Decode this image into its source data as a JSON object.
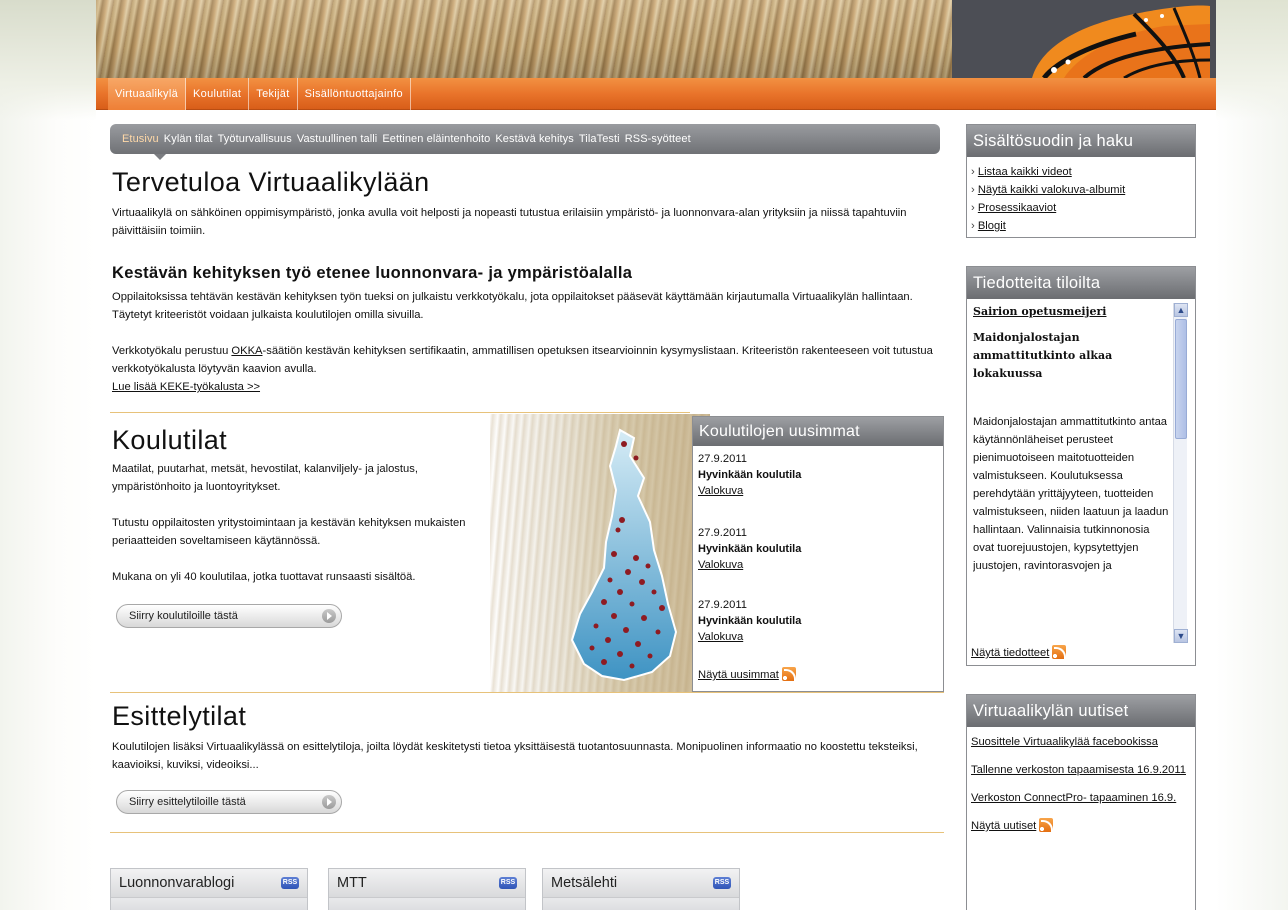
{
  "main_nav": {
    "items": [
      {
        "label": "Virtuaalikylä",
        "active": true
      },
      {
        "label": "Koulutilat",
        "active": false
      },
      {
        "label": "Tekijät",
        "active": false
      },
      {
        "label": "Sisällöntuottajainfo",
        "active": false
      }
    ]
  },
  "sub_nav": {
    "items": [
      {
        "label": "Etusivu",
        "active": true
      },
      {
        "label": "Kylän tilat"
      },
      {
        "label": "Työturvallisuus"
      },
      {
        "label": "Vastuullinen talli"
      },
      {
        "label": "Eettinen eläintenhoito"
      },
      {
        "label": "Kestävä kehitys"
      },
      {
        "label": "TilaTesti"
      },
      {
        "label": "RSS-syötteet"
      }
    ]
  },
  "welcome": {
    "title": "Tervetuloa Virtuaalikylään",
    "text": "Virtuaalikylä on sähköinen oppimisympäristö, jonka avulla voit helposti ja nopeasti tutustua erilaisiin ympäristö- ja luonnonvara-alan yrityksiin ja niissä tapahtuviin päivittäisiin toimiin."
  },
  "keke": {
    "title": "Kestävän kehityksen työ etenee luonnonvara- ja ympäristöalalla",
    "text1": "Oppilaitoksissa tehtävän kestävän kehityksen työn tueksi on julkaistu verkkotyökalu, jota oppilaitokset pääsevät käyttämään kirjautumalla Virtuaalikylän hallintaan. Täytetyt kriteeristöt voidaan julkaista koulutilojen omilla sivuilla.",
    "text2_before": "Verkkotyökalu perustuu ",
    "text2_link": "OKKA",
    "text2_after": "-säätiön kestävän kehityksen sertifikaatin, ammatillisen opetuksen itsearvioinnin kysymyslistaan. Kriteeristön rakenteeseen voit tutustua verkkotyökalusta löytyvän kaavion avulla.",
    "read_more": "Lue lisää KEKE-työkalusta >>"
  },
  "koulutilat": {
    "title": "Koulutilat",
    "text1": "Maatilat, puutarhat, metsät, hevostilat, kalanviljely- ja jalostus, ympäristönhoito ja luontoyritykset.",
    "text2": "Tutustu oppilaitosten yritystoimintaan ja kestävän kehityksen mukaisten periaatteiden soveltamiseen käytännössä.",
    "text3": "Mukana on yli 40 koulutilaa, jotka tuottavat runsaasti sisältöä.",
    "button": "Siirry koulutiloille tästä"
  },
  "newest": {
    "title": "Koulutilojen uusimmat",
    "items": [
      {
        "date": "27.9.2011",
        "name": "Hyvinkään koulutila",
        "link": "Valokuva"
      },
      {
        "date": "27.9.2011",
        "name": "Hyvinkään koulutila",
        "link": "Valokuva"
      },
      {
        "date": "27.9.2011",
        "name": "Hyvinkään koulutila",
        "link": "Valokuva"
      }
    ],
    "show_more": "Näytä uusimmat"
  },
  "esittelytilat": {
    "title": "Esittelytilat",
    "text": "Koulutilojen lisäksi Virtuaalikylässä on esittelytiloja, joilta löydät keskitetysti tietoa yksittäisestä tuotantosuunnasta. Monipuolinen informaatio no koostettu teksteiksi, kaavioiksi, kuviksi, videoiksi...",
    "button": "Siirry esittelytiloille tästä"
  },
  "blogs": [
    {
      "title": "Luonnonvarablogi",
      "badge": "RSS"
    },
    {
      "title": "MTT",
      "badge": "RSS"
    },
    {
      "title": "Metsälehti",
      "badge": "RSS"
    }
  ],
  "sidebar": {
    "filter": {
      "title": "Sisältösuodin ja haku",
      "links": [
        "Listaa kaikki videot",
        "Näytä kaikki valokuva-albumit",
        "Prosessikaaviot",
        "Blogit"
      ]
    },
    "bulletins": {
      "title": "Tiedotteita tiloilta",
      "source": "Sairion opetusmeijeri",
      "headline": "Maidonjalostajan ammattitutkinto alkaa lokakuussa",
      "body": "Maidonjalostajan ammattitutkinto antaa käytännönläheiset perusteet pienimuotoiseen maitotuotteiden valmistukseen. Koulutuksessa perehdytään yrittäjyyteen, tuotteiden valmistukseen, niiden laatuun ja laadun hallintaan. Valinnaisia tutkinnonosia ovat tuorejuustojen, kypsytettyjen juustojen, ravintorasvojen ja",
      "show_more": "Näytä tiedotteet"
    },
    "news": {
      "title": "Virtuaalikylän uutiset",
      "items": [
        "Suosittele Virtuaalikylää facebookissa",
        "Tallenne verkoston tapaamisesta 16.9.2011",
        "Verkoston ConnectPro- tapaaminen 16.9."
      ],
      "show_more": "Näytä uutiset"
    }
  }
}
